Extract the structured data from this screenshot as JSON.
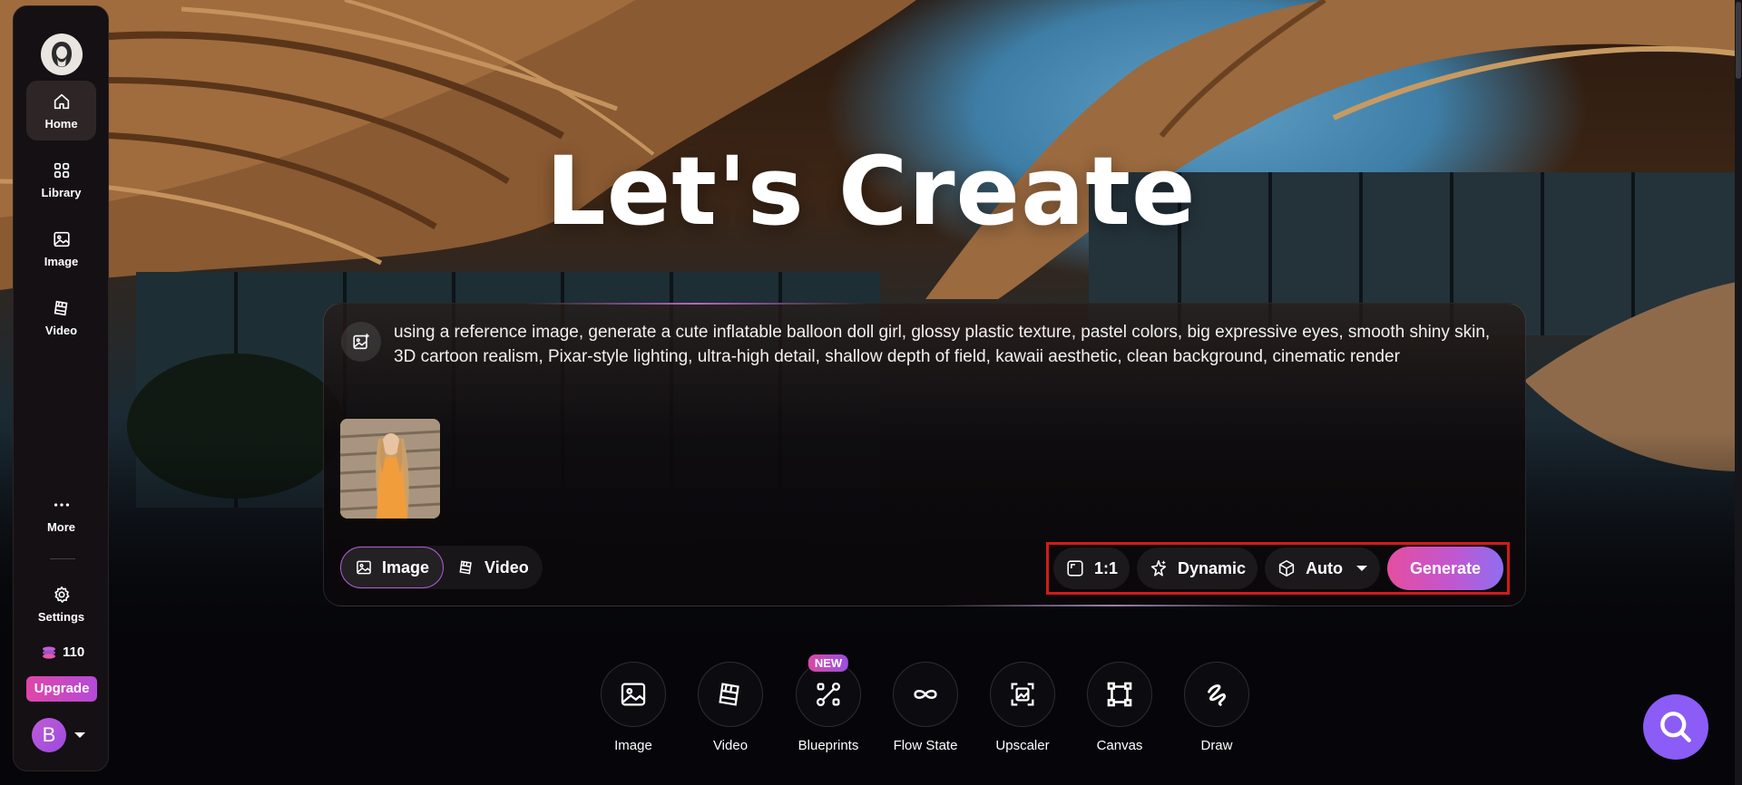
{
  "title": "Let's Create",
  "sidebar": {
    "items": [
      {
        "label": "Home"
      },
      {
        "label": "Library"
      },
      {
        "label": "Image"
      },
      {
        "label": "Video"
      },
      {
        "label": "More"
      },
      {
        "label": "Settings"
      }
    ],
    "credits": "110",
    "upgrade_label": "Upgrade",
    "avatar_initial": "B"
  },
  "composer": {
    "prompt": "using a reference image, generate a cute inflatable balloon doll girl, glossy plastic texture, pastel colors, big expressive eyes, smooth shiny skin, 3D cartoon realism, Pixar-style lighting, ultra-high detail, shallow depth of field, kawaii aesthetic, clean background, cinematic render",
    "mode_image": "Image",
    "mode_video": "Video",
    "aspect_ratio": "1:1",
    "style": "Dynamic",
    "model": "Auto",
    "generate_label": "Generate"
  },
  "tools": [
    {
      "label": "Image"
    },
    {
      "label": "Video"
    },
    {
      "label": "Blueprints",
      "badge": "NEW"
    },
    {
      "label": "Flow State"
    },
    {
      "label": "Upscaler"
    },
    {
      "label": "Canvas"
    },
    {
      "label": "Draw"
    }
  ],
  "colors": {
    "accent_pink": "#e54e9f",
    "accent_purple": "#8b5cf6",
    "highlight_red": "#d41a1a"
  }
}
